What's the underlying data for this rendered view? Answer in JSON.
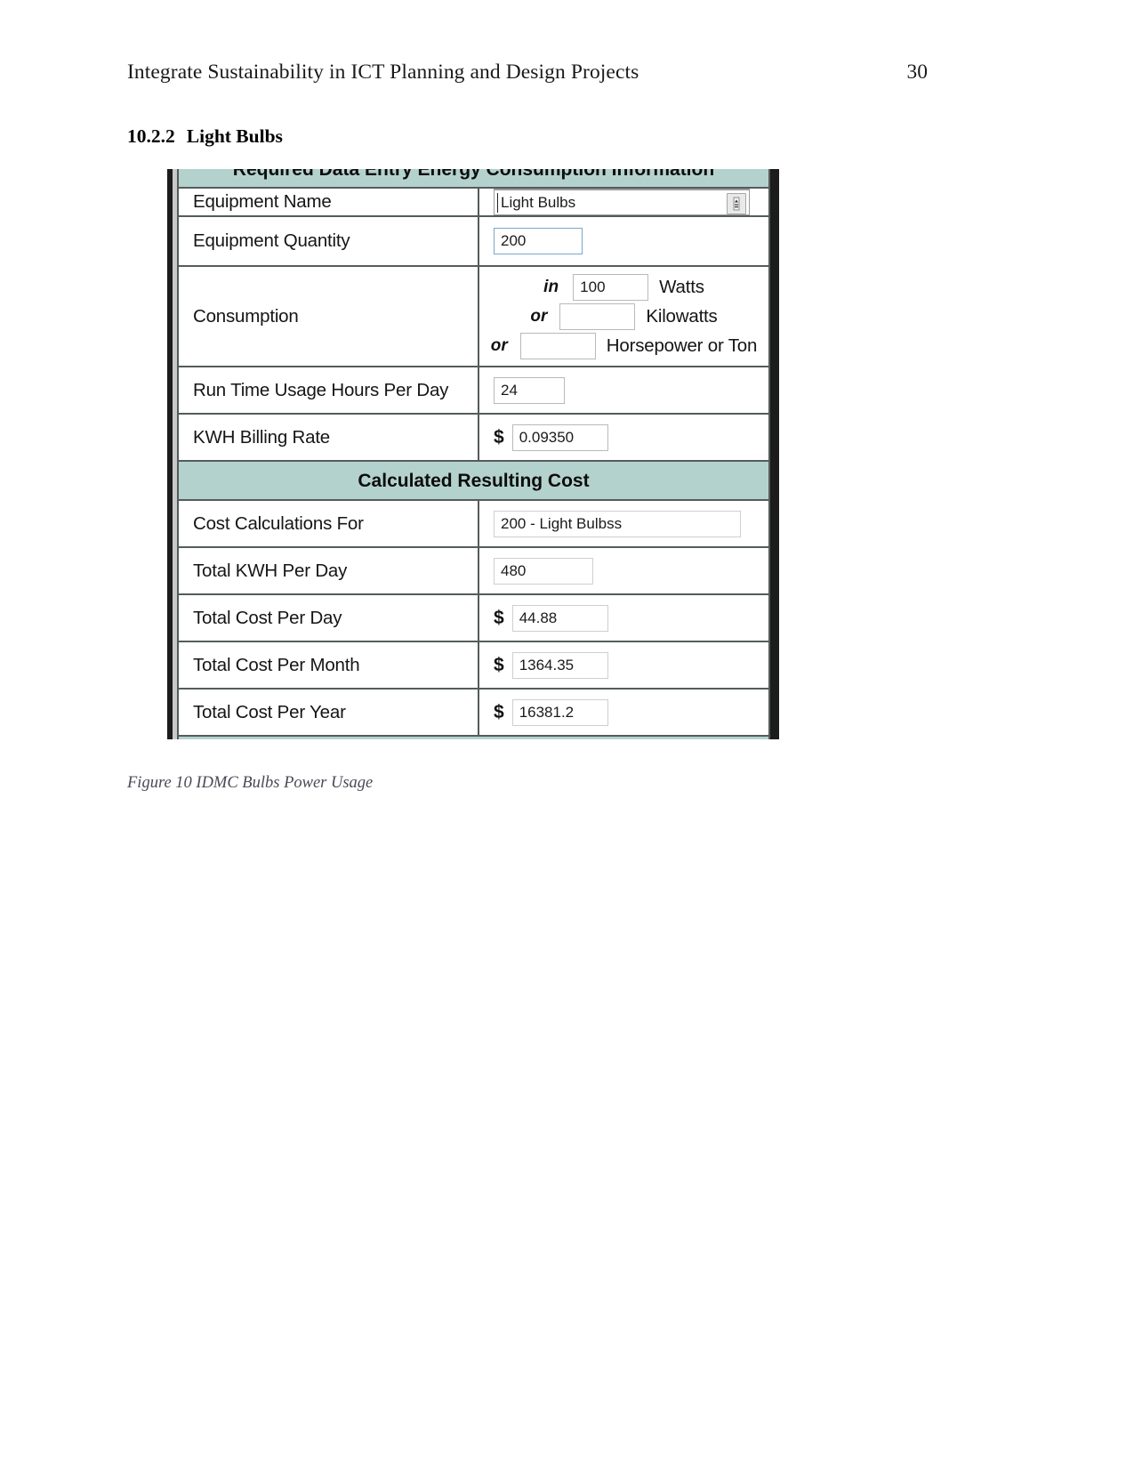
{
  "page": {
    "running_head_title": "Integrate Sustainability in ICT Planning and Design Projects",
    "page_number": "30",
    "section_number": "10.2.2",
    "section_title": "Light Bulbs",
    "figure_caption": "Figure 10 IDMC Bulbs Power Usage"
  },
  "colors": {
    "banner_teal": "#b4d2cd",
    "grid_line": "#555b5b",
    "input_border": "#b9b9b9",
    "caption_gray": "#4a4a55"
  },
  "form": {
    "header_banner": "Required Data Entry Energy Consumption Information",
    "calculated_banner": "Calculated Resulting Cost",
    "rows": [
      {
        "label": "Equipment Name",
        "value": "Light Bulbs",
        "icon": "spinner-picker-icon"
      },
      {
        "label": "Equipment Quantity",
        "value": "200"
      },
      {
        "label": "Run Time Usage Hours Per Day",
        "value": "24"
      },
      {
        "label": "KWH Billing Rate",
        "value": "0.09350",
        "prefix": "$"
      }
    ],
    "consumption": {
      "label": "Consumption",
      "lines": [
        {
          "word": "in",
          "value": "100",
          "unit": "Watts"
        },
        {
          "word": "or",
          "value": "",
          "unit": "Kilowatts"
        },
        {
          "word": "or",
          "value": "",
          "unit": "Horsepower or Ton"
        }
      ]
    },
    "calculated_rows": [
      {
        "label": "Cost Calculations For",
        "value": "200 - Light Bulbss"
      },
      {
        "label": "Total KWH Per Day",
        "value": "480"
      },
      {
        "label": "Total Cost Per Day",
        "value": "44.88",
        "prefix": "$"
      },
      {
        "label": "Total Cost Per Month",
        "value": "1364.35",
        "prefix": "$"
      },
      {
        "label": "Total Cost Per Year",
        "value": "16381.2",
        "prefix": "$"
      }
    ]
  }
}
